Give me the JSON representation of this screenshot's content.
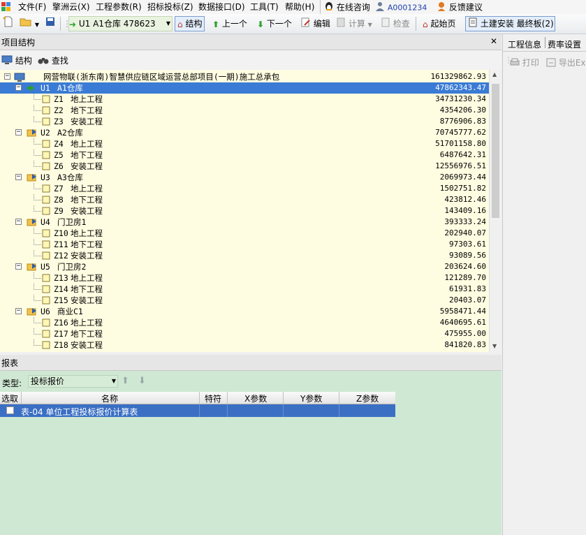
{
  "menu": [
    "文件(F)",
    "擎洲云(X)",
    "工程参数(R)",
    "招标投标(Z)",
    "数据接口(D)",
    "工具(T)",
    "帮助(H)"
  ],
  "menu_extra": {
    "online": "在线咨询",
    "user": "A0001234",
    "feedback": "反馈建议"
  },
  "toolbar": {
    "unit_selector": "U1  A1仓库 478623",
    "structure": "结构",
    "prev": "上一个",
    "next": "下一个",
    "edit": "编辑",
    "calc": "计算",
    "check": "检查",
    "home": "起始页",
    "version": "土建安装 最终板(2)"
  },
  "project_panel": {
    "title": "项目结构",
    "close": "✕",
    "structure_btn": "结构",
    "find_btn": "查找"
  },
  "tree": {
    "root": {
      "label": "网营物联(浙东南)智慧供应链区域运营总部项目(一期)施工总承包",
      "value": "161329862.93"
    },
    "units": [
      {
        "code": "U1",
        "name": "A1仓库",
        "value": "47862343.47",
        "children": [
          {
            "code": "Z1",
            "name": "地上工程",
            "value": "34731230.34"
          },
          {
            "code": "Z2",
            "name": "地下工程",
            "value": "4354206.30"
          },
          {
            "code": "Z3",
            "name": "安装工程",
            "value": "8776906.83"
          }
        ]
      },
      {
        "code": "U2",
        "name": "A2仓库",
        "value": "70745777.62",
        "children": [
          {
            "code": "Z4",
            "name": "地上工程",
            "value": "51701158.80"
          },
          {
            "code": "Z5",
            "name": "地下工程",
            "value": "6487642.31"
          },
          {
            "code": "Z6",
            "name": "安装工程",
            "value": "12556976.51"
          }
        ]
      },
      {
        "code": "U3",
        "name": "A3仓库",
        "value": "2069973.44",
        "children": [
          {
            "code": "Z7",
            "name": "地上工程",
            "value": "1502751.82"
          },
          {
            "code": "Z8",
            "name": "地下工程",
            "value": "423812.46"
          },
          {
            "code": "Z9",
            "name": "安装工程",
            "value": "143409.16"
          }
        ]
      },
      {
        "code": "U4",
        "name": "门卫房1",
        "value": "393333.24",
        "children": [
          {
            "code": "Z10",
            "name": "地上工程",
            "value": "202940.07"
          },
          {
            "code": "Z11",
            "name": "地下工程",
            "value": "97303.61"
          },
          {
            "code": "Z12",
            "name": "安装工程",
            "value": "93089.56"
          }
        ]
      },
      {
        "code": "U5",
        "name": "门卫房2",
        "value": "203624.60",
        "children": [
          {
            "code": "Z13",
            "name": "地上工程",
            "value": "121289.70"
          },
          {
            "code": "Z14",
            "name": "地下工程",
            "value": "61931.83"
          },
          {
            "code": "Z15",
            "name": "安装工程",
            "value": "20403.07"
          }
        ]
      },
      {
        "code": "U6",
        "name": "商业C1",
        "value": "5958471.44",
        "children": [
          {
            "code": "Z16",
            "name": "地上工程",
            "value": "4640695.61"
          },
          {
            "code": "Z17",
            "name": "地下工程",
            "value": "475955.00"
          },
          {
            "code": "Z18",
            "name": "安装工程",
            "value": "841820.83"
          }
        ]
      }
    ]
  },
  "report": {
    "title": "报表",
    "type_label": "类型:",
    "type_value": "投标报价",
    "columns": [
      "选取",
      "名称",
      "特符",
      "X参数",
      "Y参数",
      "Z参数"
    ],
    "rows": [
      {
        "name": "表-04  单位工程投标报价计算表",
        "checked": false
      }
    ]
  },
  "right_panel": {
    "tabs": [
      "工程信息",
      "费率设置"
    ],
    "print": "打印",
    "export": "导出Ex"
  }
}
